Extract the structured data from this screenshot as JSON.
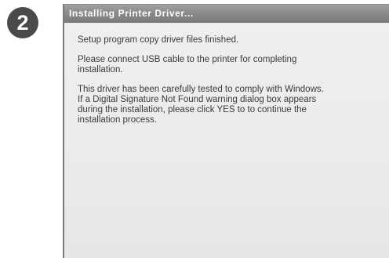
{
  "step": {
    "number": "2"
  },
  "window": {
    "title": "Installing Printer Driver..."
  },
  "messages": {
    "finished": "Setup program copy driver files finished.",
    "connect_lines": [
      "Please connect USB cable to the printer for completing",
      "installation."
    ],
    "signature_lines": [
      "This driver has been carefully tested to comply with Windows.",
      "If a Digital Signature Not Found warning dialog box appears",
      "during the installation, please click YES to to continue the",
      "installation process."
    ]
  }
}
